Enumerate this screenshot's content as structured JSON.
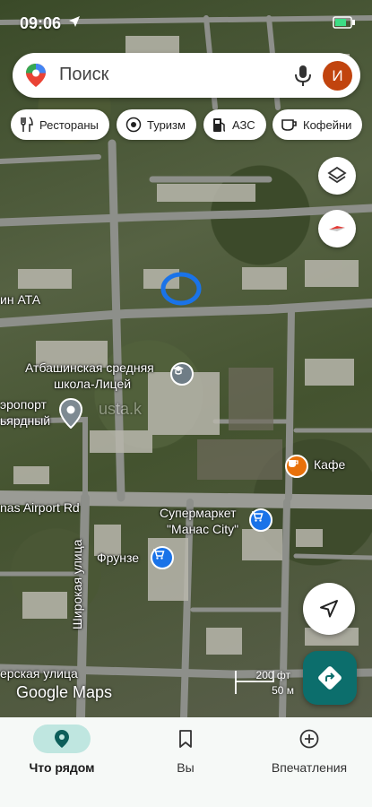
{
  "status_bar": {
    "time": "09:06"
  },
  "search": {
    "placeholder": "Поиск",
    "avatar_letter": "И"
  },
  "chips": [
    {
      "label": "Рестораны",
      "icon": "fork-knife-icon"
    },
    {
      "label": "Туризм",
      "icon": "camera-icon"
    },
    {
      "label": "АЗС",
      "icon": "gas-station-icon"
    },
    {
      "label": "Кофейни",
      "icon": "coffee-cup-icon"
    }
  ],
  "map_labels": {
    "street_top_left": "ин АТА",
    "school_line1": "Атбашинская средняя",
    "school_line2": "школа-Лицей",
    "airport_line1": "эропорт",
    "airport_line2": "ьярдный",
    "cafe": "Кафе",
    "airport_road": "nas Airport Rd",
    "supermarket_line1": "Супермаркет",
    "supermarket_line2": "\"Манас City\"",
    "frunze": "Фрунзе",
    "shirokaya": "Широкая улица",
    "lower_street": "ерская улица",
    "watermark": "usta.k"
  },
  "map_attribution": "Google Maps",
  "scale": {
    "feet": "200 фт",
    "meters": "50 м"
  },
  "bottom_nav": [
    {
      "label": "Что рядом",
      "icon": "location-pin-icon",
      "active": true
    },
    {
      "label": "Вы",
      "icon": "bookmark-icon",
      "active": false
    },
    {
      "label": "Впечатления",
      "icon": "add-circle-icon",
      "active": false
    }
  ],
  "colors": {
    "accent": "#0c6e6c",
    "avatar": "#c1440e",
    "active_tab_bg": "#bfe6e0",
    "selection": "#1a73e8"
  }
}
